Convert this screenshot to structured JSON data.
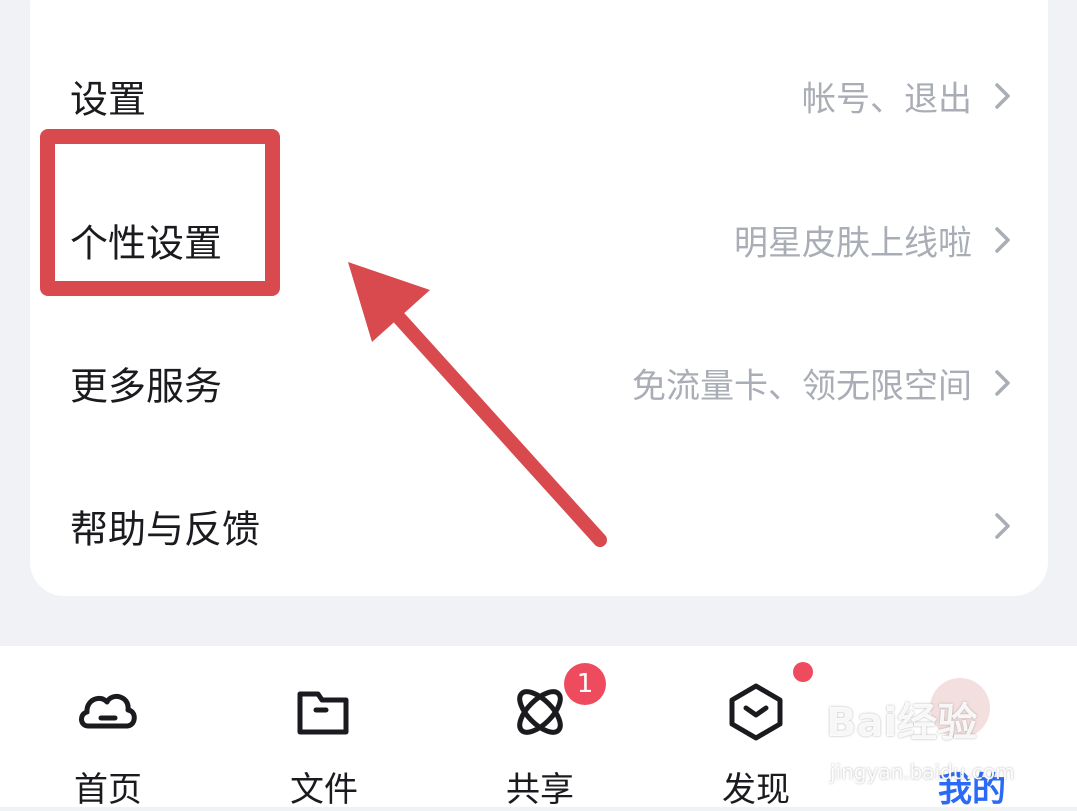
{
  "menu": {
    "items": [
      {
        "label": "设置",
        "hint": "帐号、退出"
      },
      {
        "label": "个性设置",
        "hint": "明星皮肤上线啦"
      },
      {
        "label": "更多服务",
        "hint": "免流量卡、领无限空间"
      },
      {
        "label": "帮助与反馈",
        "hint": ""
      }
    ]
  },
  "tabs": [
    {
      "label": "首页",
      "icon": "cloud-icon"
    },
    {
      "label": "文件",
      "icon": "folder-icon"
    },
    {
      "label": "共享",
      "icon": "share-orbit-icon",
      "badge": "1"
    },
    {
      "label": "发现",
      "icon": "discover-box-icon",
      "dot": true
    },
    {
      "label": "我的",
      "icon": "avatar-icon",
      "active": true
    }
  ],
  "watermark": {
    "text": "Bai经验",
    "url": "jingyan.baidu.com"
  },
  "colors": {
    "accent": "#2a6af6",
    "highlight": "#d94a4f",
    "badge": "#ef4b5e",
    "hint": "#a9adb5"
  }
}
